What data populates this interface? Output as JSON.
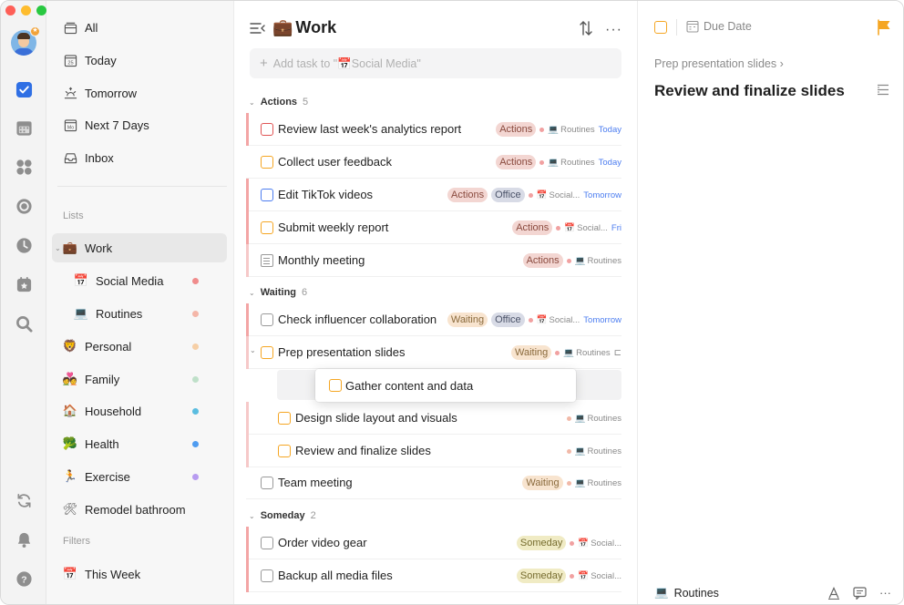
{
  "window": {
    "controls": {
      "close": "#fe5f57",
      "minimize": "#febc2e",
      "zoom": "#28c840"
    }
  },
  "rail": {
    "icons": [
      "avatar",
      "checkbox-icon",
      "calendar-icon",
      "grid-icon",
      "focus-icon",
      "clock-icon",
      "calendar-star-icon",
      "search-icon",
      "sync-icon",
      "bell-icon",
      "help-icon"
    ],
    "accent": "#2f6fe4"
  },
  "sidebar": {
    "smart_lists": [
      {
        "label": "All",
        "icon": "stack-icon"
      },
      {
        "label": "Today",
        "icon": "calendar-25-icon",
        "icon_text": "25"
      },
      {
        "label": "Tomorrow",
        "icon": "sunrise-icon"
      },
      {
        "label": "Next 7 Days",
        "icon": "calendar-mo-icon",
        "icon_text": "Mo"
      },
      {
        "label": "Inbox",
        "icon": "inbox-icon"
      }
    ],
    "lists_label": "Lists",
    "lists": [
      {
        "label": "Work",
        "emoji": "💼",
        "active": true,
        "expanded": true
      },
      {
        "label": "Social Media",
        "emoji": "📅",
        "sub": true,
        "dot": "#f08c8c"
      },
      {
        "label": "Routines",
        "emoji": "💻",
        "sub": true,
        "dot": "#f4b6a8"
      },
      {
        "label": "Personal",
        "emoji": "🦁",
        "dot": "#f6cfa6"
      },
      {
        "label": "Family",
        "emoji": "💑",
        "dot": "#bfe0c9"
      },
      {
        "label": "Household",
        "emoji": "🏠",
        "dot": "#5bbde0"
      },
      {
        "label": "Health",
        "emoji": "🥦",
        "dot": "#4f9cf0"
      },
      {
        "label": "Exercise",
        "emoji": "🏃",
        "dot": "#b79bf0"
      },
      {
        "label": "Remodel bathroom",
        "emoji": "🛠"
      }
    ],
    "filters_label": "Filters",
    "filters": [
      {
        "label": "This Week",
        "emoji": "📅"
      }
    ]
  },
  "main": {
    "title": "Work",
    "title_emoji": "💼",
    "add_placeholder": "Add task to \"📅Social Media\"",
    "groups": [
      {
        "name": "Actions",
        "count": "5"
      },
      {
        "name": "Waiting",
        "count": "6"
      },
      {
        "name": "Someday",
        "count": "2"
      }
    ],
    "tasks": [
      {
        "name": "Review last week's analytics report",
        "tags": [
          "Actions"
        ],
        "list": "Routines",
        "list_emoji": "💻",
        "due": "Today"
      },
      {
        "name": "Collect user feedback",
        "tags": [
          "Actions"
        ],
        "list": "Routines",
        "list_emoji": "💻",
        "due": "Today"
      },
      {
        "name": "Edit TikTok videos",
        "tags": [
          "Actions",
          "Office"
        ],
        "list": "Social...",
        "list_emoji": "📅",
        "due": "Tomorrow"
      },
      {
        "name": "Submit weekly report",
        "tags": [
          "Actions"
        ],
        "list": "Social...",
        "list_emoji": "📅",
        "due": "Fri"
      },
      {
        "name": "Monthly meeting",
        "tags": [
          "Actions"
        ],
        "list": "Routines",
        "list_emoji": "💻",
        "due": ""
      },
      {
        "name": "Check influencer collaboration",
        "tags": [
          "Waiting",
          "Office"
        ],
        "list": "Social...",
        "list_emoji": "📅",
        "due": "Tomorrow"
      },
      {
        "name": "Prep presentation slides",
        "tags": [
          "Waiting"
        ],
        "list": "Routines",
        "list_emoji": "💻",
        "due": ""
      },
      {
        "name": "Gather content and data",
        "dragging": true
      },
      {
        "name": "Design slide layout and visuals",
        "tags": [],
        "list": "Routines",
        "list_emoji": "💻",
        "due": ""
      },
      {
        "name": "Review and finalize slides",
        "tags": [],
        "list": "Routines",
        "list_emoji": "💻",
        "due": ""
      },
      {
        "name": "Team meeting",
        "tags": [
          "Waiting"
        ],
        "list": "Routines",
        "list_emoji": "💻",
        "due": ""
      },
      {
        "name": "Order video gear",
        "tags": [
          "Someday"
        ],
        "list": "Social...",
        "list_emoji": "📅",
        "due": ""
      },
      {
        "name": "Backup all media files",
        "tags": [
          "Someday"
        ],
        "list": "Social...",
        "list_emoji": "📅",
        "due": ""
      }
    ]
  },
  "detail": {
    "due_label": "Due Date",
    "breadcrumb": "Prep presentation slides ›",
    "title": "Review and finalize slides",
    "list": "Routines",
    "list_emoji": "💻",
    "flag_color": "#f5a623"
  }
}
